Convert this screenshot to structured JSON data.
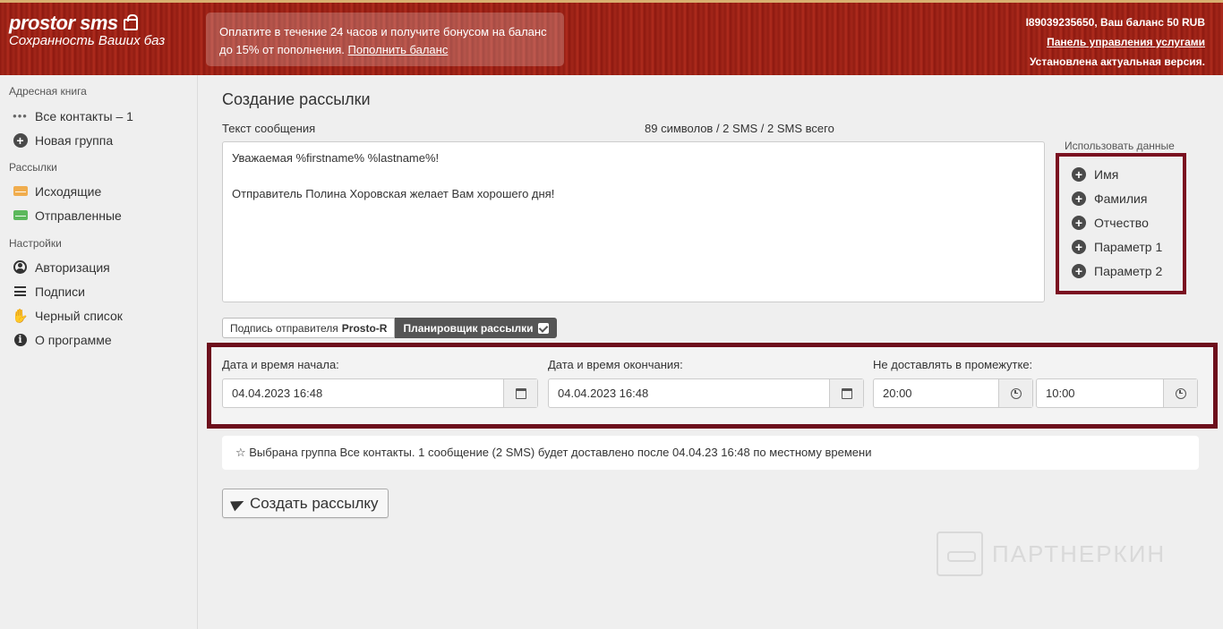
{
  "header": {
    "logo_top": "prostor sms",
    "logo_sub": "Сохранность Ваших баз",
    "promo_line1": "Оплатите в течение 24 часов и получите бонусом на баланс",
    "promo_line2": "до 15% от пополнения.",
    "promo_link": "Пополнить баланс",
    "account": "I89039235650, Ваш баланс 50 RUB",
    "services_link": "Панель управления услугами",
    "version": "Установлена актуальная версия."
  },
  "sidebar": {
    "address_title": "Адресная книга",
    "all_contacts": "Все контакты – 1",
    "new_group": "Новая группа",
    "mailings_title": "Рассылки",
    "outgoing": "Исходящие",
    "sent": "Отправленные",
    "settings_title": "Настройки",
    "auth": "Авторизация",
    "signatures": "Подписи",
    "blacklist": "Черный список",
    "about": "О программе"
  },
  "main": {
    "title": "Создание рассылки",
    "message_label": "Текст сообщения",
    "counter": "89 символов / 2 SMS / 2 SMS всего",
    "message_line1": "Уважаемая  %firstname% %lastname%!",
    "message_line2": "",
    "message_line3": "Отправитель Полина Хоровская желает Вам хорошего дня!",
    "use_data_title": "Использовать данные",
    "use_data_items": [
      "Имя",
      "Фамилия",
      "Отчество",
      "Параметр 1",
      "Параметр 2"
    ],
    "tab_sender_label": "Подпись отправителя",
    "tab_sender_value": "Prosto-R",
    "tab_scheduler": "Планировщик рассылки",
    "start_label": "Дата и время начала:",
    "start_value": "04.04.2023 16:48",
    "end_label": "Дата и время окончания:",
    "end_value": "04.04.2023 16:48",
    "nodeliver_label": "Не доставлять в промежутке:",
    "nodeliver_from": "20:00",
    "nodeliver_to": "10:00",
    "notice": "☆ Выбрана группа Все контакты. 1 сообщение (2 SMS) будет доставлено после 04.04.23 16:48 по местному времени",
    "create_button": "Создать рассылку"
  },
  "watermark": "ПАРТНЕРКИН",
  "colors": {
    "header_red": "#a3261a",
    "highlight_border": "#6d0f1c"
  }
}
